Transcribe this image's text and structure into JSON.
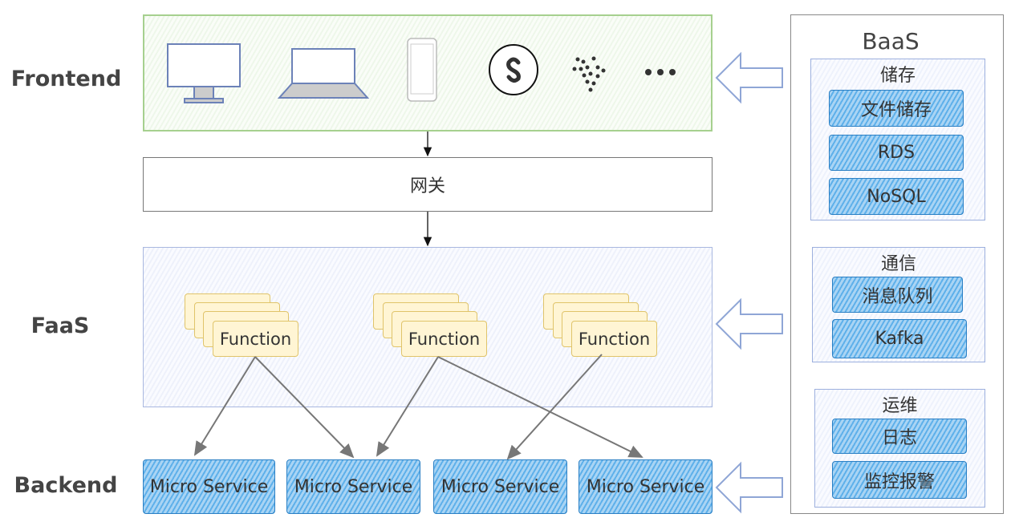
{
  "labels": {
    "frontend": "Frontend",
    "faas": "FaaS",
    "backend": "Backend"
  },
  "frontend": {
    "icons": [
      "desktop-monitor-icon",
      "laptop-icon",
      "smartphone-icon",
      "circle-s-logo-icon",
      "dot-cluster-logo-icon",
      "ellipsis-icon"
    ]
  },
  "gateway": "网关",
  "functions": [
    "Function",
    "Function",
    "Function"
  ],
  "backend": [
    "Micro Service",
    "Micro Service",
    "Micro Service",
    "Micro Service"
  ],
  "baas": {
    "title": "BaaS",
    "groups": [
      {
        "title": "储存",
        "items": [
          "文件储存",
          "RDS",
          "NoSQL"
        ]
      },
      {
        "title": "通信",
        "items": [
          "消息队列",
          "Kafka"
        ]
      },
      {
        "title": "运维",
        "items": [
          "日志",
          "监控报警"
        ]
      }
    ]
  },
  "colors": {
    "frontend": "#a6d08f",
    "faas": "#a9b8e0",
    "service": "#5eb0ea",
    "function": "#fff5d4"
  }
}
